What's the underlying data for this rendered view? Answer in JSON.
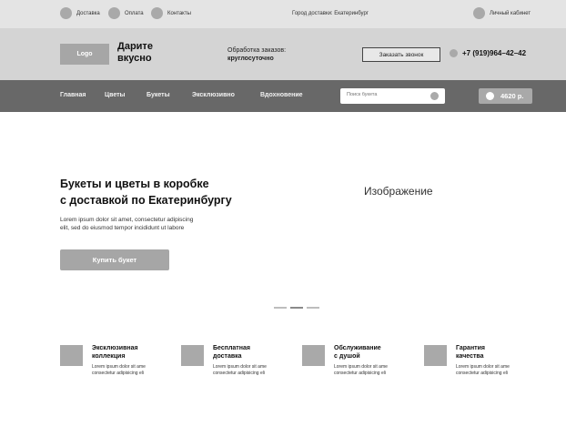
{
  "topbar": {
    "links": [
      "Доставка",
      "Оплата",
      "Контакты"
    ],
    "city": "Город доставки: Екатеринбург",
    "account": "Личный кабинет"
  },
  "header": {
    "logo": "Logo",
    "brand_line1": "Дарите",
    "brand_line2": "вкусно",
    "hours_label": "Обработка заказов:",
    "hours_value": "круглосуточно",
    "callback": "Заказать звонок",
    "phone": "+7 (919)964–42–42"
  },
  "nav": {
    "items": [
      "Главная",
      "Цветы",
      "Букеты",
      "Эксклюзивно",
      "Вдохновение"
    ],
    "search_placeholder": "Поиск букета",
    "cart_total": "4620 р."
  },
  "hero": {
    "title_line1": "Букеты и цветы в коробке",
    "title_line2": "с доставкой по Екатеринбургу",
    "text_line1": "Lorem ipsum dolor sit amet, consectetur adipiscing",
    "text_line2": "elit, sed do eiusmod tempor incididunt ut labore",
    "button": "Купить букет",
    "image_label": "Изображение",
    "slides_count": 3,
    "active_slide": 2
  },
  "features": [
    {
      "title_line1": "Эксклюзивная",
      "title_line2": "коллекция",
      "text_line1": "Lorem ipsum dolor sit ame",
      "text_line2": "consectetur adipisicing eli"
    },
    {
      "title_line1": "Бесплатная",
      "title_line2": "доставка",
      "text_line1": "Lorem ipsum dolor sit ame",
      "text_line2": "consectetur adipisicing eli"
    },
    {
      "title_line1": "Обслуживание",
      "title_line2": "с душой",
      "text_line1": "Lorem ipsum dolor sit ame",
      "text_line2": "consectetur adipisicing eli"
    },
    {
      "title_line1": "Гарантия",
      "title_line2": "качества",
      "text_line1": "Lorem ipsum dolor sit ame",
      "text_line2": "consectetur adipisicing eli"
    }
  ]
}
